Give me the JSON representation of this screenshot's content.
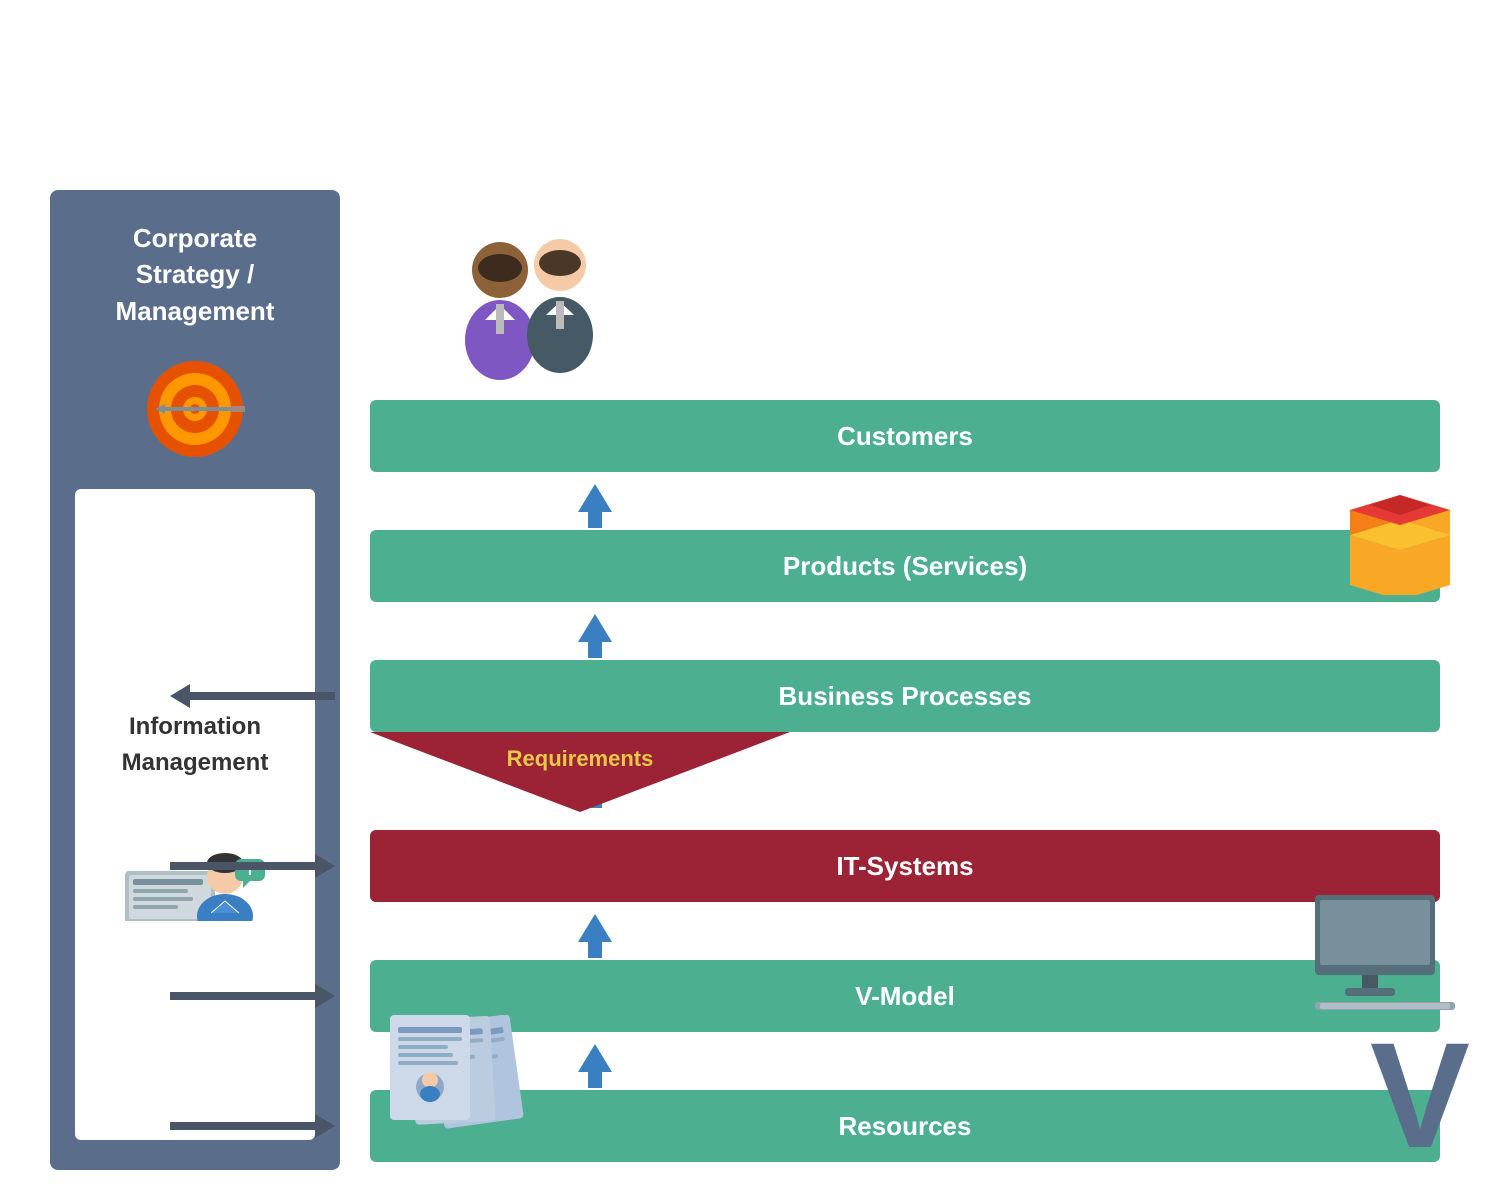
{
  "sidebar": {
    "corporate_label": "Corporate\nStrategy /\nManagement",
    "info_label": "Information\nManagement"
  },
  "layers": [
    {
      "id": "customers",
      "label": "Customers",
      "type": "green"
    },
    {
      "id": "products",
      "label": "Products (Services)",
      "type": "green"
    },
    {
      "id": "business",
      "label": "Business Processes",
      "type": "green"
    },
    {
      "id": "requirements",
      "label": "Requirements",
      "type": "req"
    },
    {
      "id": "it-systems",
      "label": "IT-Systems",
      "type": "red"
    },
    {
      "id": "v-model",
      "label": "V-Model",
      "type": "green"
    },
    {
      "id": "resources",
      "label": "Resources",
      "type": "green"
    }
  ],
  "colors": {
    "green": "#4caf8f",
    "red_banner": "#9b2335",
    "sidebar_bg": "#5a6e8c",
    "arrow_blue": "#3a7fc1",
    "arrow_dark": "#4a5568"
  }
}
